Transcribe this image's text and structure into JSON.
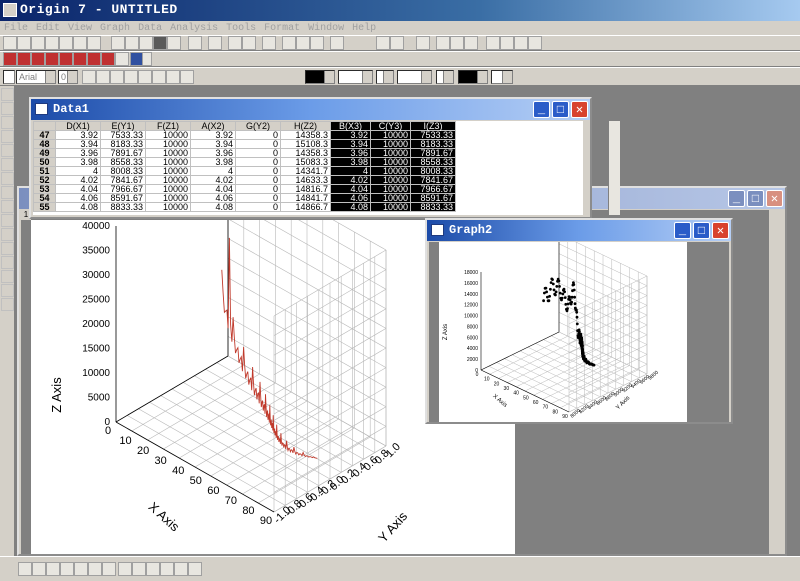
{
  "app": {
    "title": "Origin 7 - UNTITLED"
  },
  "menu": [
    "File",
    "Edit",
    "View",
    "Graph",
    "Data",
    "Analysis",
    "Tools",
    "Format",
    "Window",
    "Help"
  ],
  "format_toolbar": {
    "font": "Arial",
    "size": "0"
  },
  "data_window": {
    "title": "Data1",
    "columns": [
      "D(X1)",
      "E(Y1)",
      "F(Z1)",
      "A(X2)",
      "G(Y2)",
      "H(Z2)",
      "B(X3)",
      "C(Y3)",
      "I(Z3)"
    ],
    "rows": [
      [
        "47",
        "3.92",
        "7533.33",
        "10000",
        "3.92",
        "0",
        "14358.3",
        "3.92",
        "10000",
        "7533.33"
      ],
      [
        "48",
        "3.94",
        "8183.33",
        "10000",
        "3.94",
        "0",
        "15108.3",
        "3.94",
        "10000",
        "8183.33"
      ],
      [
        "49",
        "3.96",
        "7891.67",
        "10000",
        "3.96",
        "0",
        "14358.3",
        "3.96",
        "10000",
        "7891.67"
      ],
      [
        "50",
        "3.98",
        "8558.33",
        "10000",
        "3.98",
        "0",
        "15083.3",
        "3.98",
        "10000",
        "8558.33"
      ],
      [
        "51",
        "4",
        "8008.33",
        "10000",
        "4",
        "0",
        "14341.7",
        "4",
        "10000",
        "8008.33"
      ],
      [
        "52",
        "4.02",
        "7841.67",
        "10000",
        "4.02",
        "0",
        "14633.3",
        "4.02",
        "10000",
        "7841.67"
      ],
      [
        "53",
        "4.04",
        "7966.67",
        "10000",
        "4.04",
        "0",
        "14816.7",
        "4.04",
        "10000",
        "7966.67"
      ],
      [
        "54",
        "4.06",
        "8591.67",
        "10000",
        "4.06",
        "0",
        "14841.7",
        "4.06",
        "10000",
        "8591.67"
      ],
      [
        "55",
        "4.08",
        "8833.33",
        "10000",
        "4.08",
        "0",
        "14866.7",
        "4.08",
        "10000",
        "8833.33"
      ]
    ]
  },
  "graph1": {
    "layer": "1",
    "z_axis_label": "Z Axis",
    "x_axis_label": "X Axis",
    "y_axis_label": "Y Axis",
    "z_ticks": [
      "40000",
      "35000",
      "30000",
      "25000",
      "20000",
      "15000",
      "10000",
      "5000",
      "0"
    ],
    "x_ticks": [
      "0",
      "10",
      "20",
      "30",
      "40",
      "50",
      "60",
      "70",
      "80",
      "90"
    ],
    "y_ticks": [
      "-1.0",
      "-0.8",
      "-0.6",
      "-0.4",
      "-0.2",
      "0.0",
      "0.2",
      "0.4",
      "0.6",
      "0.8",
      "1.0"
    ],
    "line_color": "#c0392b"
  },
  "graph2": {
    "title": "Graph2",
    "layer": "1",
    "z_axis_label": "Z Axis",
    "x_axis_label": "X Axis",
    "y_axis_label": "Y Axis",
    "z_ticks": [
      "18000",
      "16000",
      "14000",
      "12000",
      "10000",
      "8000",
      "6000",
      "4000",
      "2000",
      "0"
    ],
    "x_ticks": [
      "0",
      "10",
      "20",
      "30",
      "40",
      "50",
      "60",
      "70",
      "80",
      "90"
    ],
    "y_ticks": [
      "8000",
      "8200",
      "8400",
      "8600",
      "8800",
      "9000",
      "9200",
      "9400",
      "9600",
      "9800"
    ]
  }
}
